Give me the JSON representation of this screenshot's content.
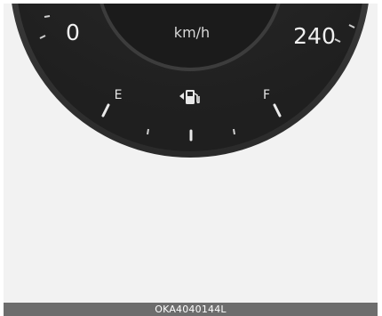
{
  "gauge": {
    "speed_min_label": "0",
    "speed_max_label": "240",
    "unit": "km/h",
    "fuel_empty_label": "E",
    "fuel_full_label": "F",
    "fuel_icon": "fuel-pump-icon",
    "colors": {
      "bezel": "#3a3a3a",
      "dial_face": "#232323",
      "inner_dial": "#1a1a1a",
      "text": "#f0f0f0",
      "tick": "#e8e8e8",
      "background": "#f2f2f2"
    }
  },
  "caption": {
    "code": "OKA4040144L"
  }
}
